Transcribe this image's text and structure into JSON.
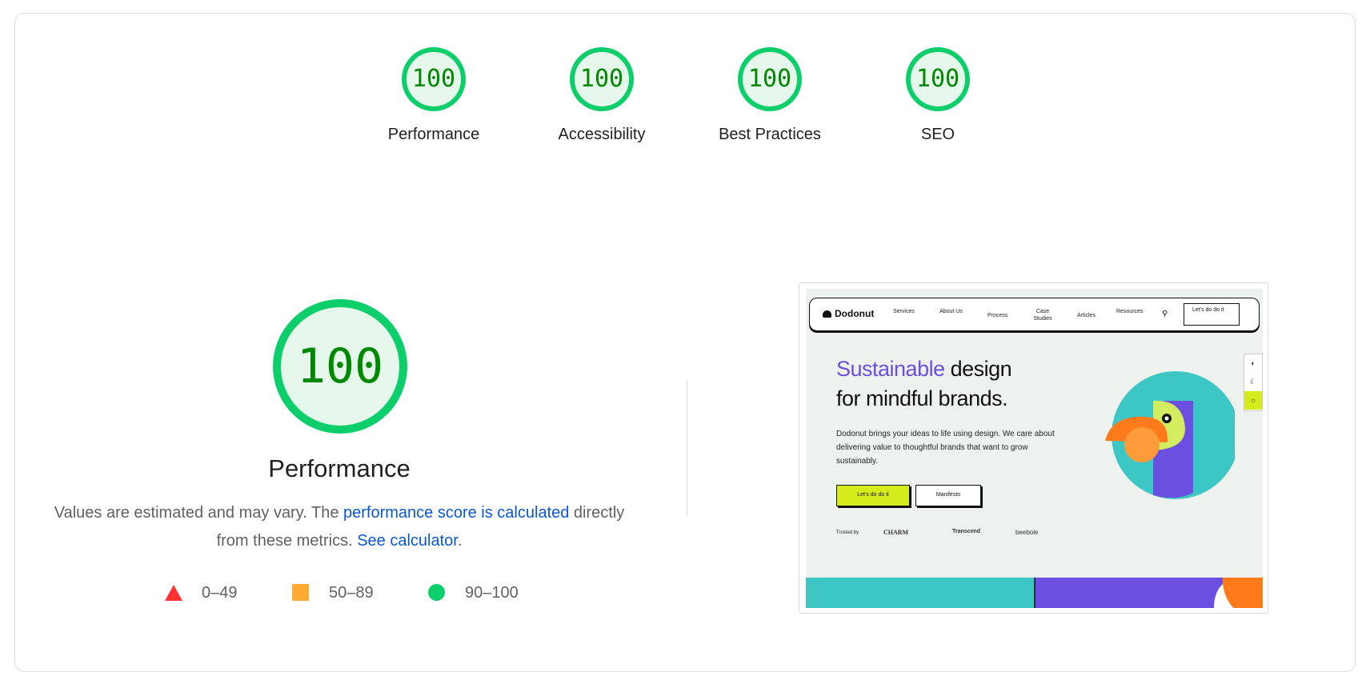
{
  "categories": [
    {
      "label": "Performance",
      "score": "100"
    },
    {
      "label": "Accessibility",
      "score": "100"
    },
    {
      "label": "Best Practices",
      "score": "100"
    },
    {
      "label": "SEO",
      "score": "100"
    }
  ],
  "performance": {
    "score": "100",
    "title": "Performance",
    "desc_before": "Values are estimated and may vary. The ",
    "desc_link1": "performance score is calculated",
    "desc_middle": " directly from these metrics. ",
    "desc_link2": "See calculator",
    "desc_after": "."
  },
  "legend": {
    "fail": "0–49",
    "average": "50–89",
    "pass": "90–100"
  },
  "colors": {
    "pass": "#0cce6b",
    "pass_text": "#008800",
    "pass_fill": "#e6f8ec",
    "average": "#ffaa33",
    "fail": "#ff3333",
    "link": "#0b57d0"
  },
  "screenshot": {
    "logo": "Dodonut",
    "nav": [
      "Services",
      "About Us",
      "Process",
      "Case Studies",
      "Articles",
      "Resources"
    ],
    "nav_cta": "Let's do do it",
    "hero_accent": "Sustainable",
    "hero_rest1": " design",
    "hero_line2": "for mindful brands.",
    "hero_text": "Dodonut brings your ideas to life using design. We care about delivering value to thoughtful brands that want to grow sustainably.",
    "btn_primary": "Let's do do it",
    "btn_secondary": "Manifesto",
    "trusted_by": "Trusted by",
    "brands": [
      "CHARM",
      "Transcend",
      "beebole"
    ]
  }
}
